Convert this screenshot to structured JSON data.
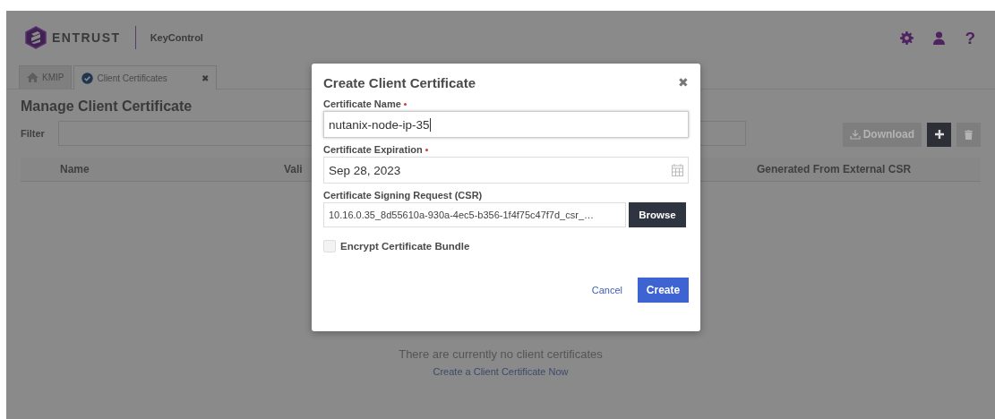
{
  "header": {
    "brand": "ENTRUST",
    "product": "KeyControl",
    "help": "?"
  },
  "tabs": [
    {
      "label": "KMIP",
      "selected": false
    },
    {
      "label": "Client Certificates",
      "selected": true,
      "close": "✖"
    }
  ],
  "page": {
    "title": "Manage Client Certificate",
    "filter_label": "Filter",
    "actions": [
      {
        "kind": "download",
        "label": "Download",
        "disabled": true
      },
      {
        "kind": "add",
        "disabled": false
      },
      {
        "kind": "delete",
        "disabled": true
      }
    ],
    "table": {
      "columns": [
        "Name",
        "Vali",
        "Generated From External CSR"
      ]
    },
    "empty_message": "There are currently no client certificates",
    "empty_link": "Create a Client Certificate Now"
  },
  "dialog": {
    "title": "Create Client Certificate",
    "close": "✖",
    "fields": [
      {
        "kind": "text",
        "label": "Certificate Name",
        "required": true,
        "value": "nutanix-node-ip-35"
      },
      {
        "kind": "date",
        "label": "Certificate Expiration",
        "required": true,
        "value": "Sep 28, 2023"
      },
      {
        "kind": "file",
        "label": "Certificate Signing Request (CSR)",
        "required": false,
        "value": "10.16.0.35_8d55610a-930a-4ec5-b356-1f4f75c47f7d_csr_…",
        "button": "Browse"
      }
    ],
    "checkbox": {
      "label": "Encrypt Certificate Bundle",
      "checked": false
    },
    "cancel": "Cancel",
    "submit": "Create"
  }
}
